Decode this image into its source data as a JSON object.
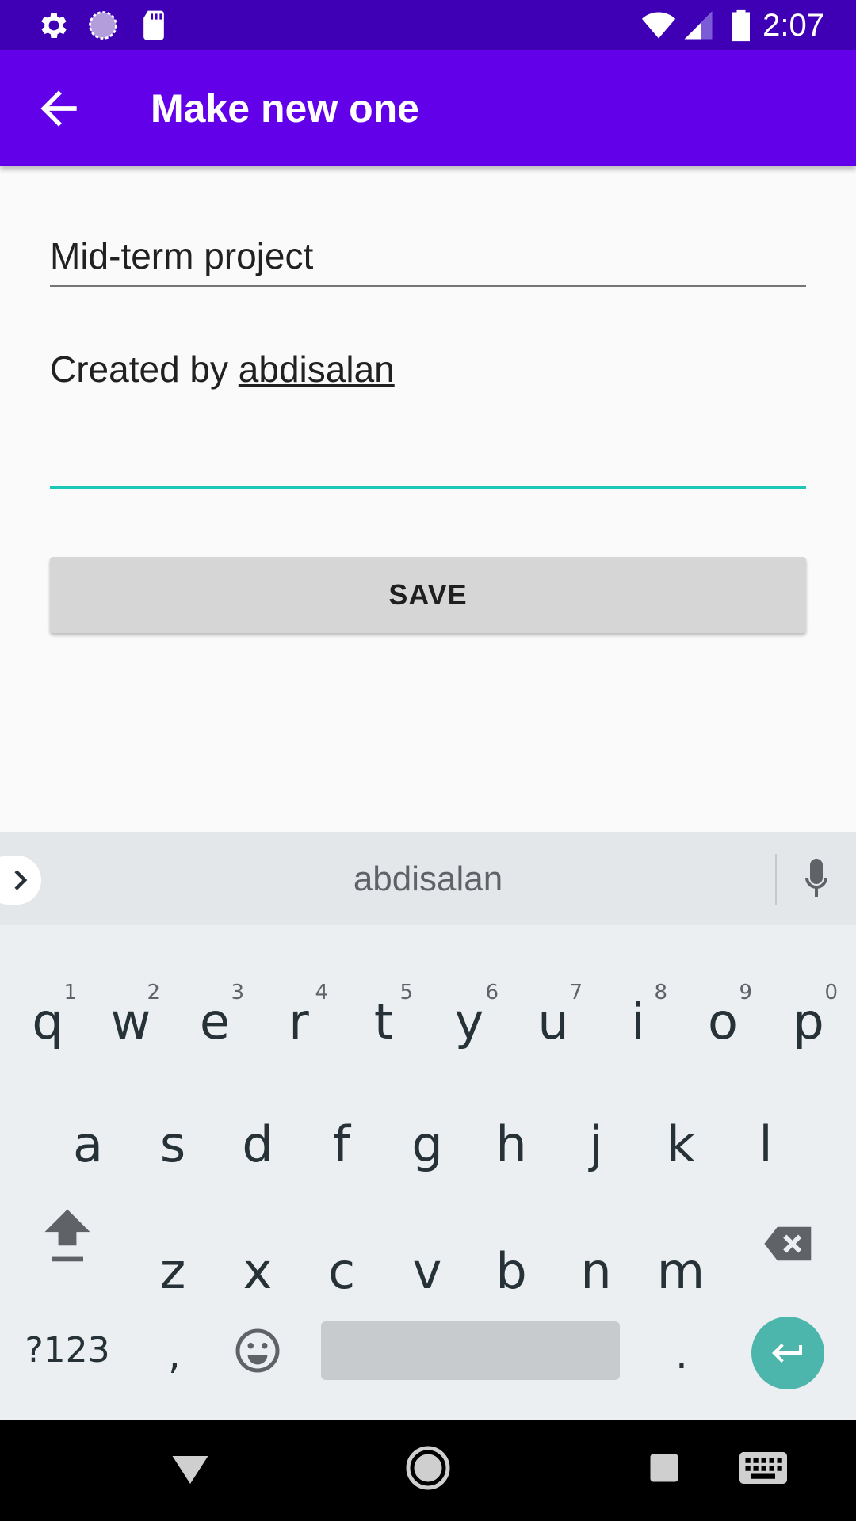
{
  "status_bar": {
    "time": "2:07",
    "icons": [
      "settings-icon",
      "sync-icon",
      "sd-card-icon",
      "wifi-icon",
      "signal-icon",
      "battery-icon"
    ]
  },
  "app_bar": {
    "title": "Make new one",
    "back_icon": "arrow-back-icon"
  },
  "form": {
    "title_value": "Mid-term project",
    "description_prefix": "Created by ",
    "description_link": "abdisalan",
    "save_label": "SAVE"
  },
  "keyboard": {
    "suggestion": "abdisalan",
    "row1": [
      {
        "key": "q",
        "hint": "1"
      },
      {
        "key": "w",
        "hint": "2"
      },
      {
        "key": "e",
        "hint": "3"
      },
      {
        "key": "r",
        "hint": "4"
      },
      {
        "key": "t",
        "hint": "5"
      },
      {
        "key": "y",
        "hint": "6"
      },
      {
        "key": "u",
        "hint": "7"
      },
      {
        "key": "i",
        "hint": "8"
      },
      {
        "key": "o",
        "hint": "9"
      },
      {
        "key": "p",
        "hint": "0"
      }
    ],
    "row2": [
      "a",
      "s",
      "d",
      "f",
      "g",
      "h",
      "j",
      "k",
      "l"
    ],
    "row3": [
      "z",
      "x",
      "c",
      "v",
      "b",
      "n",
      "m"
    ],
    "symbols_label": "?123",
    "comma": ",",
    "period": ".",
    "accent_color": "#4db6ac"
  },
  "colors": {
    "status_bar": "#3f00b5",
    "app_bar": "#6200ea",
    "focus_underline": "#1ec8b8"
  }
}
